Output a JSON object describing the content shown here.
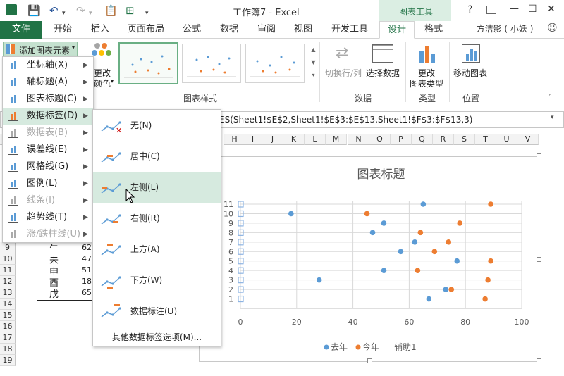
{
  "title_bar": {
    "doc_title": "工作簿7 - Excel",
    "context_tool": "图表工具",
    "help": "?",
    "minimize": "—",
    "restore": "☐",
    "close": "✕"
  },
  "tabs": [
    "文件",
    "开始",
    "插入",
    "页面布局",
    "公式",
    "数据",
    "审阅",
    "视图",
    "开发工具",
    "设计",
    "格式"
  ],
  "user": "方洁影 ( 小妖 )",
  "ribbon": {
    "add_element": "添加图表元素",
    "change_colors_1": "更改",
    "change_colors_2": "颜色",
    "chart_styles_group": "图表样式",
    "switch_rowcol": "切换行/列",
    "select_data": "选择数据",
    "data_group": "数据",
    "change_type_1": "更改",
    "change_type_2": "图表类型",
    "type_group": "类型",
    "move_chart": "移动图表",
    "location_group": "位置"
  },
  "formula_text": "ES(Sheet1!$E$2,Sheet1!$E$3:$E$13,Sheet1!$F$3:$F$13,3)",
  "columns": [
    "H",
    "I",
    "J",
    "K",
    "L",
    "M",
    "N",
    "O",
    "P",
    "Q",
    "R",
    "S",
    "T",
    "U",
    "V"
  ],
  "rows": [
    "9",
    "10",
    "11",
    "12",
    "13",
    "14",
    "15",
    "16",
    "17",
    "18",
    "19"
  ],
  "cells": [
    {
      "label": "午",
      "value": "62"
    },
    {
      "label": "未",
      "value": "47"
    },
    {
      "label": "申",
      "value": "51"
    },
    {
      "label": "酉",
      "value": "18"
    },
    {
      "label": "戌",
      "value": "65"
    }
  ],
  "menu1": [
    {
      "label": "坐标轴(X)",
      "icon": "axes-icon",
      "disabled": false
    },
    {
      "label": "轴标题(A)",
      "icon": "axis-title-icon",
      "disabled": false
    },
    {
      "label": "图表标题(C)",
      "icon": "chart-title-icon",
      "disabled": false
    },
    {
      "label": "数据标签(D)",
      "icon": "data-labels-icon",
      "disabled": false
    },
    {
      "label": "数据表(B)",
      "icon": "data-table-icon",
      "disabled": true
    },
    {
      "label": "误差线(E)",
      "icon": "error-bars-icon",
      "disabled": false
    },
    {
      "label": "网格线(G)",
      "icon": "gridlines-icon",
      "disabled": false
    },
    {
      "label": "图例(L)",
      "icon": "legend-icon",
      "disabled": false
    },
    {
      "label": "线条(I)",
      "icon": "lines-icon",
      "disabled": true
    },
    {
      "label": "趋势线(T)",
      "icon": "trendline-icon",
      "disabled": false
    },
    {
      "label": "涨/跌柱线(U)",
      "icon": "updown-bars-icon",
      "disabled": true
    }
  ],
  "menu2": [
    {
      "label": "无(N)",
      "icon": "none-icon"
    },
    {
      "label": "居中(C)",
      "icon": "center-icon"
    },
    {
      "label": "左侧(L)",
      "icon": "left-icon"
    },
    {
      "label": "右侧(R)",
      "icon": "right-icon"
    },
    {
      "label": "上方(A)",
      "icon": "above-icon"
    },
    {
      "label": "下方(W)",
      "icon": "below-icon"
    },
    {
      "label": "数据标注(U)",
      "icon": "callout-icon"
    }
  ],
  "menu2_more": "其他数据标签选项(M)...",
  "colors": {
    "accent": "#217346",
    "series1": "#5b9bd5",
    "series2": "#ed7d31",
    "hover": "#d6eadf"
  },
  "chart_data": {
    "type": "scatter",
    "title": "图表标题",
    "xlim": [
      0,
      100
    ],
    "ylim": [
      0,
      11
    ],
    "x_ticks": [
      "0",
      "20",
      "40",
      "60",
      "80",
      "100"
    ],
    "y_ticks": [
      "1",
      "2",
      "3",
      "4",
      "5",
      "6",
      "7",
      "8",
      "9",
      "10",
      "11"
    ],
    "legend_position": "bottom",
    "series": [
      {
        "name": "去年",
        "color": "#5b9bd5",
        "points": [
          [
            67,
            1
          ],
          [
            73,
            2
          ],
          [
            28,
            3
          ],
          [
            51,
            4
          ],
          [
            77,
            5
          ],
          [
            57,
            6
          ],
          [
            62,
            7
          ],
          [
            47,
            8
          ],
          [
            51,
            9
          ],
          [
            18,
            10
          ],
          [
            65,
            11
          ]
        ]
      },
      {
        "name": "今年",
        "color": "#ed7d31",
        "points": [
          [
            87,
            1
          ],
          [
            75,
            2
          ],
          [
            88,
            3
          ],
          [
            63,
            4
          ],
          [
            89,
            5
          ],
          [
            69,
            6
          ],
          [
            74,
            7
          ],
          [
            64,
            8
          ],
          [
            78,
            9
          ],
          [
            45,
            10
          ],
          [
            89,
            11
          ]
        ]
      },
      {
        "name": "辅助1",
        "color": "#8db3e2",
        "points": [
          [
            0,
            1
          ],
          [
            0,
            2
          ],
          [
            0,
            3
          ],
          [
            0,
            4
          ],
          [
            0,
            5
          ],
          [
            0,
            6
          ],
          [
            0,
            7
          ],
          [
            0,
            8
          ],
          [
            0,
            9
          ],
          [
            0,
            10
          ],
          [
            0,
            11
          ]
        ]
      }
    ]
  }
}
